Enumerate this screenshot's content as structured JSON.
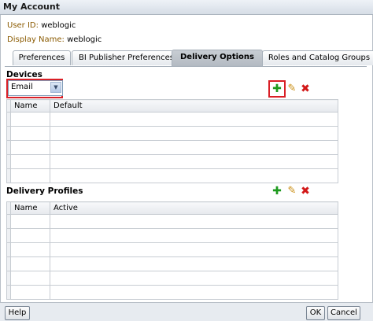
{
  "window": {
    "title": "My Account"
  },
  "user": {
    "user_id_label": "User ID:",
    "user_id_value": "weblogic",
    "display_name_label": "Display Name:",
    "display_name_value": "weblogic"
  },
  "tabs": [
    {
      "label": "Preferences",
      "active": false
    },
    {
      "label": "BI Publisher Preferences",
      "active": false
    },
    {
      "label": "Delivery Options",
      "active": true
    },
    {
      "label": "Roles and Catalog Groups",
      "active": false
    }
  ],
  "devices": {
    "title": "Devices",
    "device_type": "Email",
    "columns": [
      "Name",
      "Default"
    ],
    "rows": [
      [
        "",
        ""
      ],
      [
        "",
        ""
      ],
      [
        "",
        ""
      ],
      [
        "",
        ""
      ],
      [
        "",
        ""
      ]
    ]
  },
  "profiles": {
    "title": "Delivery Profiles",
    "columns": [
      "Name",
      "Active"
    ],
    "rows": [
      [
        "",
        ""
      ],
      [
        "",
        ""
      ],
      [
        "",
        ""
      ],
      [
        "",
        ""
      ],
      [
        "",
        ""
      ],
      [
        "",
        ""
      ]
    ]
  },
  "icons": {
    "add": "plus-icon",
    "edit": "pencil-icon",
    "delete": "x-icon"
  },
  "footer": {
    "help_label": "Help",
    "ok_label": "OK",
    "cancel_label": "Cancel"
  }
}
